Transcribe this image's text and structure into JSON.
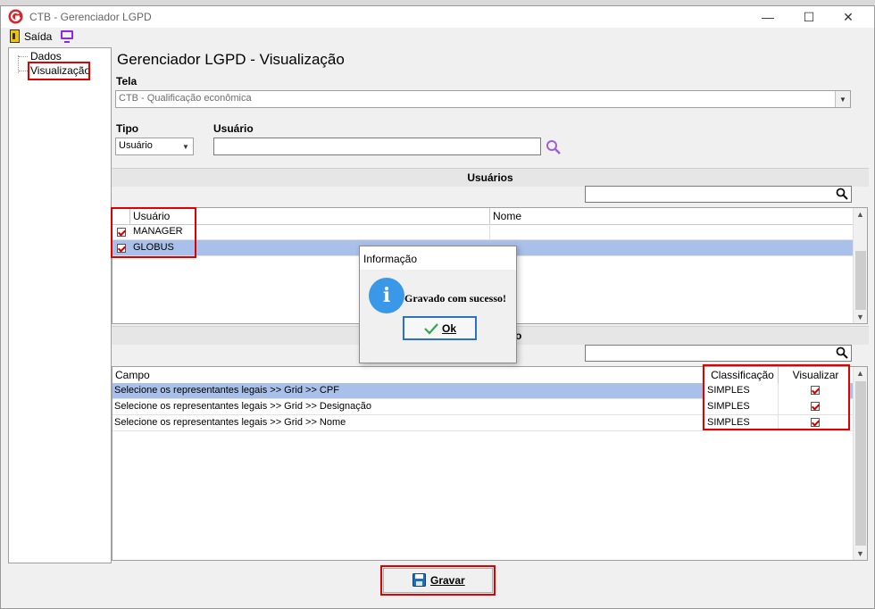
{
  "window": {
    "title": "CTB - Gerenciador LGPD",
    "minimize": "—",
    "maximize": "☐",
    "close": "✕"
  },
  "toolbar": {
    "exit_label": "Saída"
  },
  "tree": {
    "items": [
      "Dados",
      "Visualização"
    ]
  },
  "page_title": "Gerenciador LGPD - Visualização",
  "form": {
    "tela_label": "Tela",
    "tela_value": "CTB - Qualificação econômica",
    "tipo_label": "Tipo",
    "tipo_value": "Usuário",
    "usuario_label": "Usuário",
    "usuario_value": ""
  },
  "users_section": {
    "title": "Usuários",
    "columns": [
      "Usuário",
      "Nome"
    ],
    "rows": [
      {
        "checked": true,
        "user": "MANAGER",
        "name": ""
      },
      {
        "checked": true,
        "user": "GLOBUS",
        "name": ""
      }
    ]
  },
  "fields_section": {
    "title_suffix": "o",
    "columns": [
      "Campo",
      "Classificação",
      "Visualizar"
    ],
    "rows": [
      {
        "campo": "Selecione os representantes legais >> Grid >> CPF",
        "classificacao": "SIMPLES",
        "visualizar": true
      },
      {
        "campo": "Selecione os representantes legais >> Grid >> Designação",
        "classificacao": "SIMPLES",
        "visualizar": true
      },
      {
        "campo": "Selecione os representantes legais >> Grid >> Nome",
        "classificacao": "SIMPLES",
        "visualizar": true
      }
    ]
  },
  "dialog": {
    "title": "Informação",
    "message": "Gravado com sucesso!",
    "ok_label": "Ok"
  },
  "save_button": {
    "label": "Gravar"
  },
  "colors": {
    "selection": "#a9c0ea",
    "highlight_red": "#e00000",
    "info_blue": "#3a98e8",
    "accent_purple": "#8a2be2"
  }
}
